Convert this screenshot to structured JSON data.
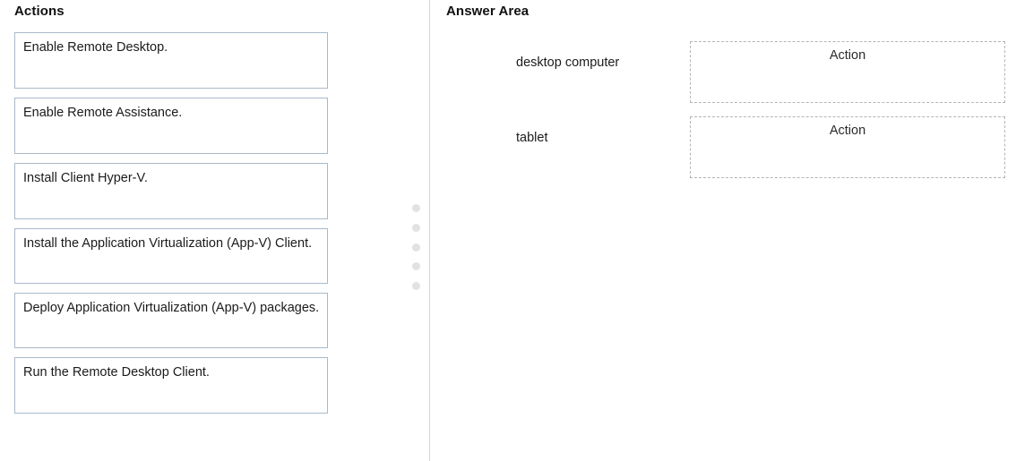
{
  "columns": {
    "actions_heading": "Actions",
    "answer_area_heading": "Answer Area"
  },
  "actions": {
    "items": [
      {
        "label": "Enable Remote Desktop."
      },
      {
        "label": "Enable Remote Assistance."
      },
      {
        "label": "Install Client Hyper-V."
      },
      {
        "label": "Install the Application Virtualization (App-V) Client."
      },
      {
        "label": "Deploy Application Virtualization (App-V) packages."
      },
      {
        "label": "Run the Remote Desktop Client."
      }
    ]
  },
  "answer_area": {
    "rows": [
      {
        "label": "desktop computer",
        "placeholder": "Action"
      },
      {
        "label": "tablet",
        "placeholder": "Action"
      }
    ]
  },
  "drag_grip": {
    "name": "drag-handle-dots",
    "dot_count": 5,
    "dot_color": "#e2e2e2"
  },
  "colors": {
    "tile_border": "#a9b9c9",
    "drop_border": "#b4b4b4",
    "divider": "#d8d8d8",
    "text": "#1b1b1b",
    "background": "#ffffff"
  }
}
